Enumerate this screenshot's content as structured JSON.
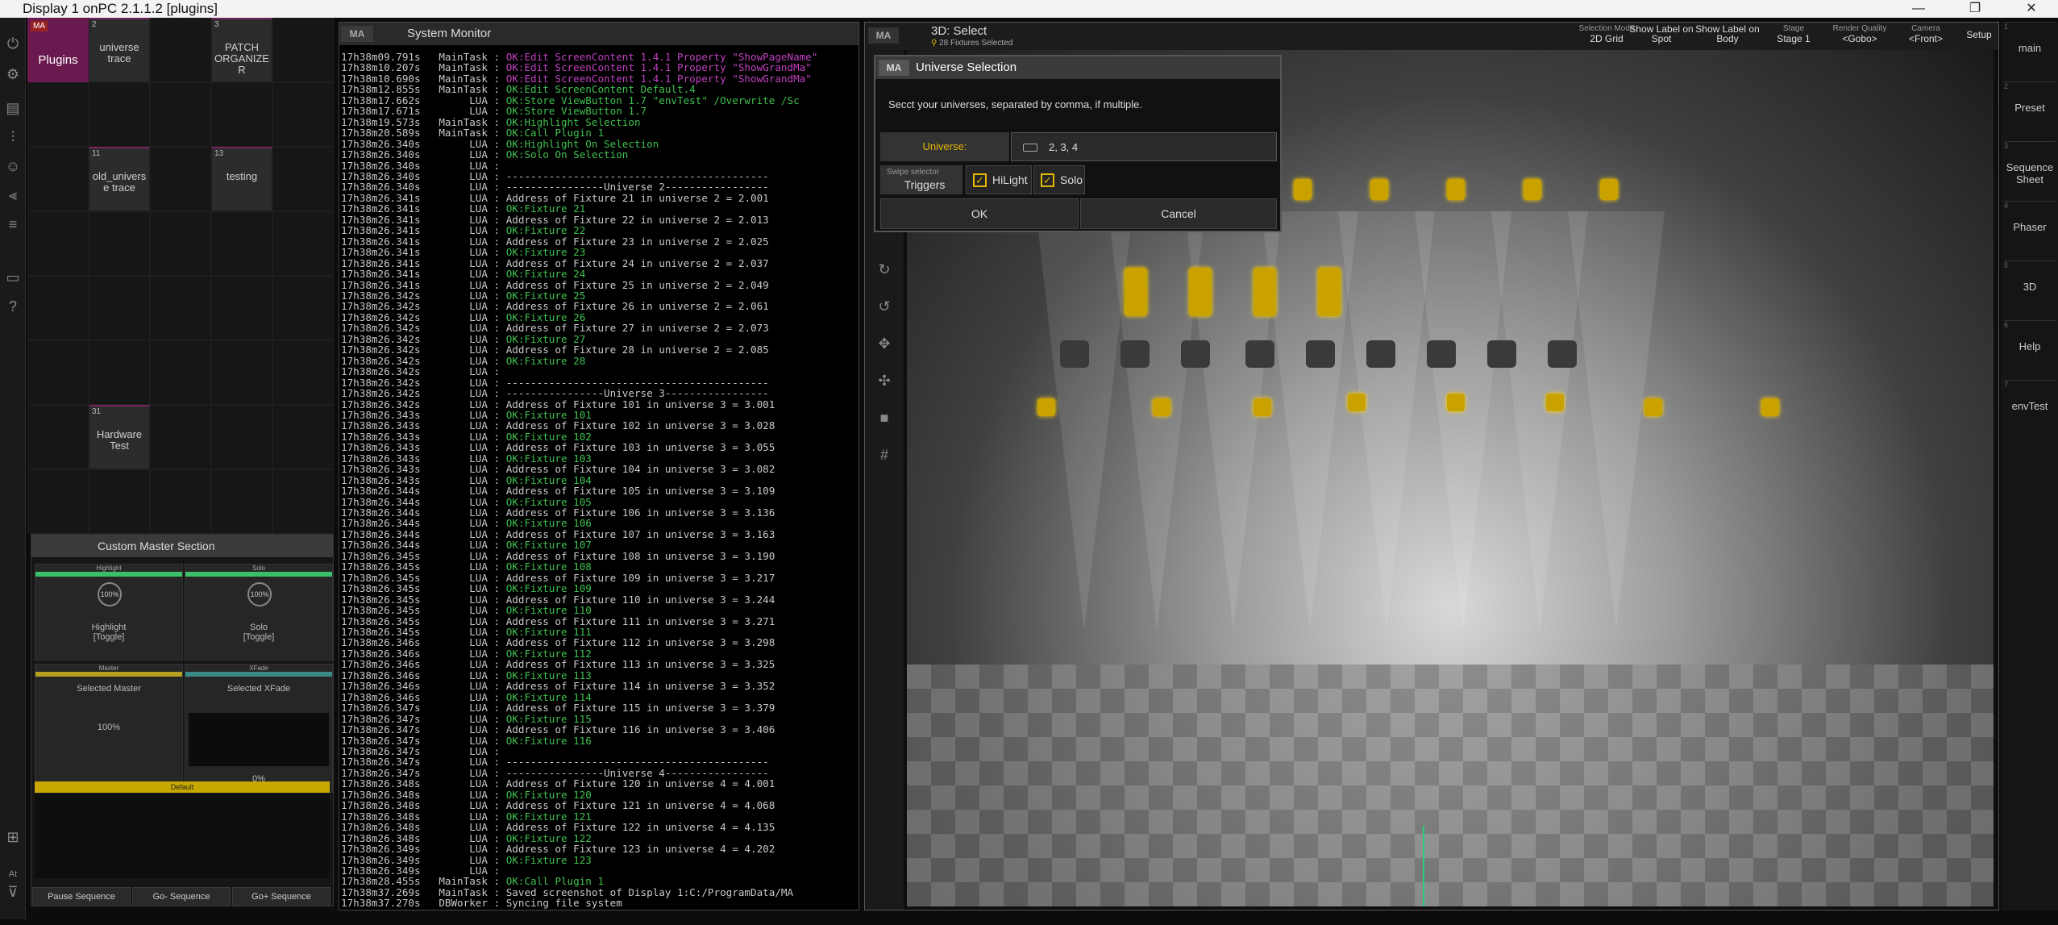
{
  "window": {
    "title": "Display 1 onPC 2.1.1.2 [plugins]",
    "minimize": "—",
    "maximize": "❐",
    "close": "✕"
  },
  "plugins": {
    "title": "Plugins",
    "items": [
      {
        "num": "2",
        "label": "universe trace"
      },
      {
        "num": "3",
        "label": "PATCH ORGANIZE R"
      },
      {
        "num": "11",
        "label": "old_univers e trace"
      },
      {
        "num": "13",
        "label": "testing"
      },
      {
        "num": "31",
        "label": "Hardware Test"
      }
    ]
  },
  "cms": {
    "title": "Custom Master Section",
    "highlight_cap": "Highlight",
    "solo_cap": "Solo",
    "knob1": "100%",
    "knob2": "100%",
    "highlight_label": "Highlight",
    "highlight_sub": "[Toggle]",
    "solo_label": "Solo",
    "solo_sub": "[Toggle]",
    "master_cap": "Master",
    "xfade_cap": "XFade",
    "sel_master": "Selected Master",
    "sel_xfade": "Selected XFade",
    "master_val": "100%",
    "xfade_val": "0%",
    "default": "Default",
    "pause": "Pause Sequence",
    "go_minus": "Go- Sequence",
    "go_plus": "Go+ Sequence"
  },
  "sysmon": {
    "title": "System Monitor",
    "logo": "MA",
    "lines": [
      {
        "t": "17h38m09.791s",
        "src": "MainTask",
        "msg": "OK:Edit ScreenContent 1.4.1 Property \"ShowPageName\"",
        "c": "warn"
      },
      {
        "t": "17h38m10.207s",
        "src": "MainTask",
        "msg": "OK:Edit ScreenContent 1.4.1 Property \"ShowGrandMa\"",
        "c": "warn"
      },
      {
        "t": "17h38m10.690s",
        "src": "MainTask",
        "msg": "OK:Edit ScreenContent 1.4.1 Property \"ShowGrandMa\"",
        "c": "warn"
      },
      {
        "t": "17h38m12.855s",
        "src": "MainTask",
        "msg": "OK:Edit ScreenContent Default.4",
        "c": "ok"
      },
      {
        "t": "17h38m17.662s",
        "src": "LUA",
        "msg": "OK:Store ViewButton 1.7 \"envTest\" /Overwrite /Sc",
        "c": "ok"
      },
      {
        "t": "17h38m17.671s",
        "src": "LUA",
        "msg": "OK:Store ViewButton 1.7",
        "c": "ok"
      },
      {
        "t": "17h38m19.573s",
        "src": "MainTask",
        "msg": "OK:Highlight Selection",
        "c": "ok"
      },
      {
        "t": "17h38m20.589s",
        "src": "MainTask",
        "msg": "OK:Call Plugin 1",
        "c": "ok"
      },
      {
        "t": "17h38m26.340s",
        "src": "LUA",
        "msg": "OK:Highlight On Selection",
        "c": "ok"
      },
      {
        "t": "17h38m26.340s",
        "src": "LUA",
        "msg": "OK:Solo On Selection",
        "c": "ok"
      },
      {
        "t": "17h38m26.340s",
        "src": "LUA",
        "msg": "",
        "c": ""
      },
      {
        "t": "17h38m26.340s",
        "src": "LUA",
        "msg": "-------------------------------------------",
        "c": ""
      },
      {
        "t": "17h38m26.340s",
        "src": "LUA",
        "msg": "----------------Universe 2-----------------",
        "c": ""
      },
      {
        "t": "17h38m26.341s",
        "src": "LUA",
        "msg": "Address of Fixture 21 in universe 2 = 2.001",
        "c": ""
      },
      {
        "t": "17h38m26.341s",
        "src": "LUA",
        "msg": "OK:Fixture 21",
        "c": "ok"
      },
      {
        "t": "17h38m26.341s",
        "src": "LUA",
        "msg": "Address of Fixture 22 in universe 2 = 2.013",
        "c": ""
      },
      {
        "t": "17h38m26.341s",
        "src": "LUA",
        "msg": "OK:Fixture 22",
        "c": "ok"
      },
      {
        "t": "17h38m26.341s",
        "src": "LUA",
        "msg": "Address of Fixture 23 in universe 2 = 2.025",
        "c": ""
      },
      {
        "t": "17h38m26.341s",
        "src": "LUA",
        "msg": "OK:Fixture 23",
        "c": "ok"
      },
      {
        "t": "17h38m26.341s",
        "src": "LUA",
        "msg": "Address of Fixture 24 in universe 2 = 2.037",
        "c": ""
      },
      {
        "t": "17h38m26.341s",
        "src": "LUA",
        "msg": "OK:Fixture 24",
        "c": "ok"
      },
      {
        "t": "17h38m26.341s",
        "src": "LUA",
        "msg": "Address of Fixture 25 in universe 2 = 2.049",
        "c": ""
      },
      {
        "t": "17h38m26.342s",
        "src": "LUA",
        "msg": "OK:Fixture 25",
        "c": "ok"
      },
      {
        "t": "17h38m26.342s",
        "src": "LUA",
        "msg": "Address of Fixture 26 in universe 2 = 2.061",
        "c": ""
      },
      {
        "t": "17h38m26.342s",
        "src": "LUA",
        "msg": "OK:Fixture 26",
        "c": "ok"
      },
      {
        "t": "17h38m26.342s",
        "src": "LUA",
        "msg": "Address of Fixture 27 in universe 2 = 2.073",
        "c": ""
      },
      {
        "t": "17h38m26.342s",
        "src": "LUA",
        "msg": "OK:Fixture 27",
        "c": "ok"
      },
      {
        "t": "17h38m26.342s",
        "src": "LUA",
        "msg": "Address of Fixture 28 in universe 2 = 2.085",
        "c": ""
      },
      {
        "t": "17h38m26.342s",
        "src": "LUA",
        "msg": "OK:Fixture 28",
        "c": "ok"
      },
      {
        "t": "17h38m26.342s",
        "src": "LUA",
        "msg": "",
        "c": ""
      },
      {
        "t": "17h38m26.342s",
        "src": "LUA",
        "msg": "-------------------------------------------",
        "c": ""
      },
      {
        "t": "17h38m26.342s",
        "src": "LUA",
        "msg": "----------------Universe 3-----------------",
        "c": ""
      },
      {
        "t": "17h38m26.342s",
        "src": "LUA",
        "msg": "Address of Fixture 101 in universe 3 = 3.001",
        "c": ""
      },
      {
        "t": "17h38m26.343s",
        "src": "LUA",
        "msg": "OK:Fixture 101",
        "c": "ok"
      },
      {
        "t": "17h38m26.343s",
        "src": "LUA",
        "msg": "Address of Fixture 102 in universe 3 = 3.028",
        "c": ""
      },
      {
        "t": "17h38m26.343s",
        "src": "LUA",
        "msg": "OK:Fixture 102",
        "c": "ok"
      },
      {
        "t": "17h38m26.343s",
        "src": "LUA",
        "msg": "Address of Fixture 103 in universe 3 = 3.055",
        "c": ""
      },
      {
        "t": "17h38m26.343s",
        "src": "LUA",
        "msg": "OK:Fixture 103",
        "c": "ok"
      },
      {
        "t": "17h38m26.343s",
        "src": "LUA",
        "msg": "Address of Fixture 104 in universe 3 = 3.082",
        "c": ""
      },
      {
        "t": "17h38m26.343s",
        "src": "LUA",
        "msg": "OK:Fixture 104",
        "c": "ok"
      },
      {
        "t": "17h38m26.344s",
        "src": "LUA",
        "msg": "Address of Fixture 105 in universe 3 = 3.109",
        "c": ""
      },
      {
        "t": "17h38m26.344s",
        "src": "LUA",
        "msg": "OK:Fixture 105",
        "c": "ok"
      },
      {
        "t": "17h38m26.344s",
        "src": "LUA",
        "msg": "Address of Fixture 106 in universe 3 = 3.136",
        "c": ""
      },
      {
        "t": "17h38m26.344s",
        "src": "LUA",
        "msg": "OK:Fixture 106",
        "c": "ok"
      },
      {
        "t": "17h38m26.344s",
        "src": "LUA",
        "msg": "Address of Fixture 107 in universe 3 = 3.163",
        "c": ""
      },
      {
        "t": "17h38m26.344s",
        "src": "LUA",
        "msg": "OK:Fixture 107",
        "c": "ok"
      },
      {
        "t": "17h38m26.345s",
        "src": "LUA",
        "msg": "Address of Fixture 108 in universe 3 = 3.190",
        "c": ""
      },
      {
        "t": "17h38m26.345s",
        "src": "LUA",
        "msg": "OK:Fixture 108",
        "c": "ok"
      },
      {
        "t": "17h38m26.345s",
        "src": "LUA",
        "msg": "Address of Fixture 109 in universe 3 = 3.217",
        "c": ""
      },
      {
        "t": "17h38m26.345s",
        "src": "LUA",
        "msg": "OK:Fixture 109",
        "c": "ok"
      },
      {
        "t": "17h38m26.345s",
        "src": "LUA",
        "msg": "Address of Fixture 110 in universe 3 = 3.244",
        "c": ""
      },
      {
        "t": "17h38m26.345s",
        "src": "LUA",
        "msg": "OK:Fixture 110",
        "c": "ok"
      },
      {
        "t": "17h38m26.345s",
        "src": "LUA",
        "msg": "Address of Fixture 111 in universe 3 = 3.271",
        "c": ""
      },
      {
        "t": "17h38m26.345s",
        "src": "LUA",
        "msg": "OK:Fixture 111",
        "c": "ok"
      },
      {
        "t": "17h38m26.346s",
        "src": "LUA",
        "msg": "Address of Fixture 112 in universe 3 = 3.298",
        "c": ""
      },
      {
        "t": "17h38m26.346s",
        "src": "LUA",
        "msg": "OK:Fixture 112",
        "c": "ok"
      },
      {
        "t": "17h38m26.346s",
        "src": "LUA",
        "msg": "Address of Fixture 113 in universe 3 = 3.325",
        "c": ""
      },
      {
        "t": "17h38m26.346s",
        "src": "LUA",
        "msg": "OK:Fixture 113",
        "c": "ok"
      },
      {
        "t": "17h38m26.346s",
        "src": "LUA",
        "msg": "Address of Fixture 114 in universe 3 = 3.352",
        "c": ""
      },
      {
        "t": "17h38m26.346s",
        "src": "LUA",
        "msg": "OK:Fixture 114",
        "c": "ok"
      },
      {
        "t": "17h38m26.347s",
        "src": "LUA",
        "msg": "Address of Fixture 115 in universe 3 = 3.379",
        "c": ""
      },
      {
        "t": "17h38m26.347s",
        "src": "LUA",
        "msg": "OK:Fixture 115",
        "c": "ok"
      },
      {
        "t": "17h38m26.347s",
        "src": "LUA",
        "msg": "Address of Fixture 116 in universe 3 = 3.406",
        "c": ""
      },
      {
        "t": "17h38m26.347s",
        "src": "LUA",
        "msg": "OK:Fixture 116",
        "c": "ok"
      },
      {
        "t": "17h38m26.347s",
        "src": "LUA",
        "msg": "",
        "c": ""
      },
      {
        "t": "17h38m26.347s",
        "src": "LUA",
        "msg": "-------------------------------------------",
        "c": ""
      },
      {
        "t": "17h38m26.347s",
        "src": "LUA",
        "msg": "----------------Universe 4-----------------",
        "c": ""
      },
      {
        "t": "17h38m26.348s",
        "src": "LUA",
        "msg": "Address of Fixture 120 in universe 4 = 4.001",
        "c": ""
      },
      {
        "t": "17h38m26.348s",
        "src": "LUA",
        "msg": "OK:Fixture 120",
        "c": "ok"
      },
      {
        "t": "17h38m26.348s",
        "src": "LUA",
        "msg": "Address of Fixture 121 in universe 4 = 4.068",
        "c": ""
      },
      {
        "t": "17h38m26.348s",
        "src": "LUA",
        "msg": "OK:Fixture 121",
        "c": "ok"
      },
      {
        "t": "17h38m26.348s",
        "src": "LUA",
        "msg": "Address of Fixture 122 in universe 4 = 4.135",
        "c": ""
      },
      {
        "t": "17h38m26.348s",
        "src": "LUA",
        "msg": "OK:Fixture 122",
        "c": "ok"
      },
      {
        "t": "17h38m26.349s",
        "src": "LUA",
        "msg": "Address of Fixture 123 in universe 4 = 4.202",
        "c": ""
      },
      {
        "t": "17h38m26.349s",
        "src": "LUA",
        "msg": "OK:Fixture 123",
        "c": "ok"
      },
      {
        "t": "17h38m26.349s",
        "src": "LUA",
        "msg": "",
        "c": ""
      },
      {
        "t": "17h38m28.455s",
        "src": "MainTask",
        "msg": "OK:Call Plugin 1",
        "c": "ok"
      },
      {
        "t": "17h38m37.269s",
        "src": "MainTask",
        "msg": "Saved screenshot of Display 1:C:/ProgramData/MA",
        "c": ""
      },
      {
        "t": "17h38m37.270s",
        "src": "DBWorker",
        "msg": "Syncing file system",
        "c": ""
      }
    ]
  },
  "view3d": {
    "title": "3D: Select",
    "subtitle": "28 Fixtures Selected",
    "buttons": [
      {
        "cap": "Selection Mode",
        "val": "2D Grid"
      },
      {
        "cap": "Show Label on Spot",
        "val": ""
      },
      {
        "cap": "Show Label on Body",
        "val": ""
      },
      {
        "cap": "Stage",
        "val": "Stage 1"
      },
      {
        "cap": "Render Quality",
        "val": "<Gobo>"
      },
      {
        "cap": "Camera",
        "val": "<Front>"
      },
      {
        "cap": "Setup",
        "val": ""
      }
    ]
  },
  "rightbar": [
    {
      "num": "1",
      "label": "main"
    },
    {
      "num": "2",
      "label": "Preset"
    },
    {
      "num": "3",
      "label": "Sequence Sheet"
    },
    {
      "num": "4",
      "label": "Phaser"
    },
    {
      "num": "5",
      "label": "3D"
    },
    {
      "num": "6",
      "label": "Help"
    },
    {
      "num": "7",
      "label": "envTest"
    }
  ],
  "dialog": {
    "title": "Universe Selection",
    "logo": "MA",
    "description": "Secct your universes, separated by comma, if multiple.",
    "universe_label": "Universe:",
    "universe_value": "2, 3, 4",
    "swipe_caption": "Swipe selector",
    "swipe_value": "Triggers",
    "hilight": "HiLight",
    "solo": "Solo",
    "ok": "OK",
    "cancel": "Cancel"
  },
  "colors": {
    "accent": "#e3b800",
    "plugin_pink": "#6b1a50",
    "ok_green": "#3fc04f",
    "warn_magenta": "#c040c0"
  }
}
